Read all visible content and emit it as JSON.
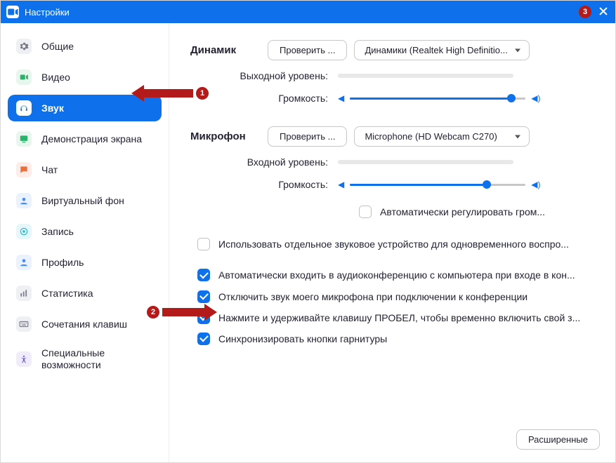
{
  "window": {
    "title": "Настройки"
  },
  "annotations": {
    "b1": "1",
    "b2": "2",
    "b3": "3"
  },
  "sidebar": {
    "items": [
      {
        "label": "Общие"
      },
      {
        "label": "Видео"
      },
      {
        "label": "Звук"
      },
      {
        "label": "Демонстрация экрана"
      },
      {
        "label": "Чат"
      },
      {
        "label": "Виртуальный фон"
      },
      {
        "label": "Запись"
      },
      {
        "label": "Профиль"
      },
      {
        "label": "Статистика"
      },
      {
        "label": "Сочетания клавиш"
      },
      {
        "label": "Специальные"
      },
      {
        "label2": "возможности"
      }
    ]
  },
  "speaker": {
    "title": "Динамик",
    "test_btn": "Проверить ...",
    "device": "Динамики (Realtek High Definitio...",
    "output_label": "Выходной уровень:",
    "volume_label": "Громкость:",
    "volume_pct": 92
  },
  "mic": {
    "title": "Микрофон",
    "test_btn": "Проверить ...",
    "device": "Microphone (HD Webcam C270)",
    "input_label": "Входной уровень:",
    "volume_label": "Громкость:",
    "volume_pct": 78,
    "auto_adjust": "Автоматически регулировать гром..."
  },
  "checks": {
    "separate_device": "Использовать отдельное звуковое устройство для одновременного воспро...",
    "auto_join": "Автоматически входить в аудиоконференцию с компьютера при входе в кон...",
    "mute_on_join": "Отключить звук моего микрофона при подключении к конференции",
    "ptt": "Нажмите и удерживайте клавишу ПРОБЕЛ, чтобы временно включить свой з...",
    "sync_headset": "Синхронизировать кнопки гарнитуры"
  },
  "footer": {
    "advanced": "Расширенные"
  }
}
